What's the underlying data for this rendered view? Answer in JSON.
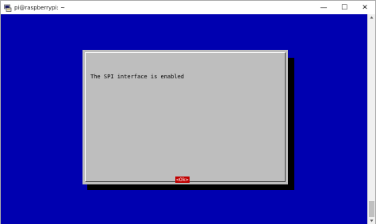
{
  "window": {
    "title": "pi@raspberrypi: ~",
    "controls": {
      "minimize": "—",
      "maximize": "☐",
      "close": "✕"
    }
  },
  "dialog": {
    "message": "The SPI interface is enabled",
    "ok_label": "<Ok>"
  },
  "colors": {
    "terminal_background": "#0000b0",
    "dialog_background": "#bebebe",
    "button_selected": "#c00000"
  },
  "icons": {
    "app": "putty-terminal-icon"
  }
}
